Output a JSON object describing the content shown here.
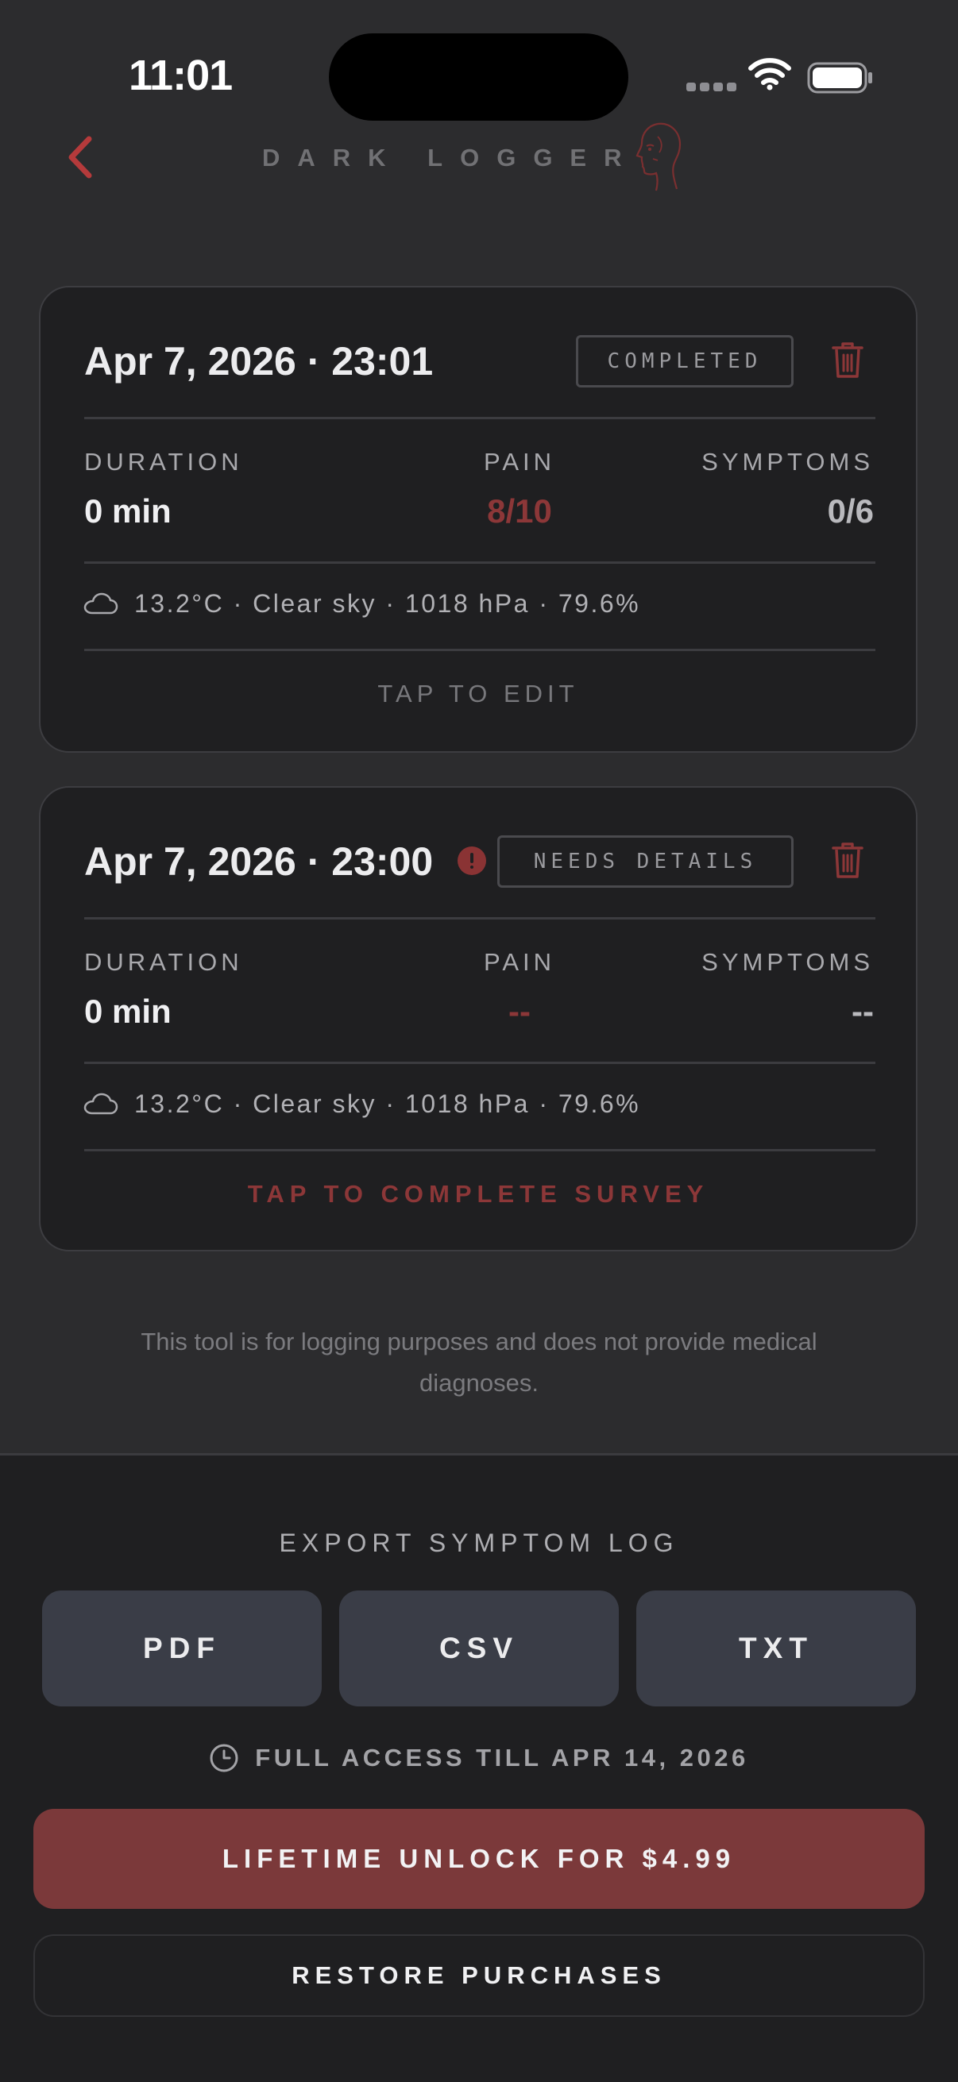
{
  "status_bar": {
    "time": "11:01"
  },
  "header": {
    "back_icon": "chevron-left-icon",
    "brand_title": "DARK LOGGER",
    "logo_icon": "face-profile-icon"
  },
  "entries": [
    {
      "title": "Apr 7, 2026 · 23:01",
      "badge": "COMPLETED",
      "stats": {
        "duration_label": "DURATION",
        "duration_value": "0 min",
        "pain_label": "PAIN",
        "pain_value": "8/10",
        "symptoms_label": "SYMPTOMS",
        "symptoms_value": "0/6"
      },
      "weather": "13.2°C · Clear sky · 1018 hPa · 79.6%",
      "action": "TAP TO EDIT"
    },
    {
      "title": "Apr 7, 2026 · 23:00",
      "badge": "NEEDS DETAILS",
      "stats": {
        "duration_label": "DURATION",
        "duration_value": "0 min",
        "pain_label": "PAIN",
        "pain_value": "--",
        "symptoms_label": "SYMPTOMS",
        "symptoms_value": "--"
      },
      "weather": "13.2°C · Clear sky · 1018 hPa · 79.6%",
      "action": "TAP TO COMPLETE SURVEY"
    }
  ],
  "disclaimer": "This tool is for logging purposes and does not provide medical diagnoses.",
  "export": {
    "title": "EXPORT SYMPTOM LOG",
    "buttons": [
      "PDF",
      "CSV",
      "TXT"
    ]
  },
  "access": {
    "text": "FULL ACCESS TILL APR 14, 2026",
    "icon": "clock-icon"
  },
  "purchase": {
    "unlock_label": "LIFETIME UNLOCK FOR $4.99",
    "restore_label": "RESTORE PURCHASES"
  },
  "colors": {
    "background": "#2c2c2e",
    "card": "#1f1f21",
    "accent_red": "#8c3738",
    "unlock_button": "#7b393a",
    "export_button": "#3a3d47"
  }
}
